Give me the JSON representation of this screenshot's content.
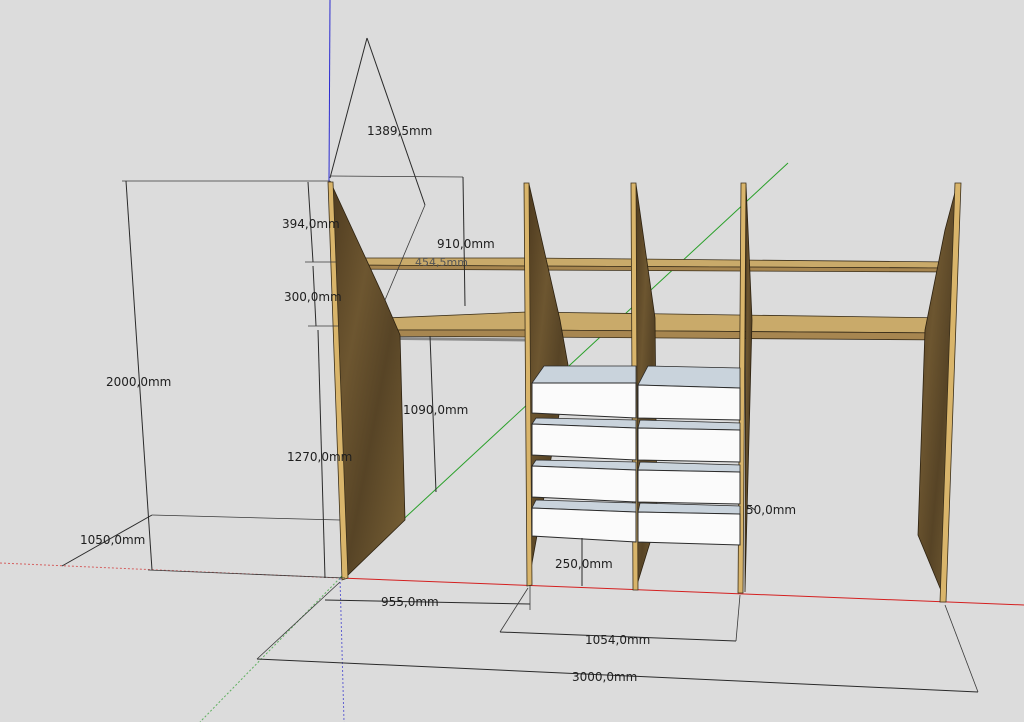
{
  "dimensions": {
    "total_height": "2000,0mm",
    "depth": "1050,0mm",
    "upper_gap": "394,0mm",
    "middle_gap": "300,0mm",
    "lower_height": "1270,0mm",
    "slope_length": "1389,5mm",
    "top_width": "910,0mm",
    "overlap_label": "454,5mm",
    "rail_height": "1090,0mm",
    "first_section": "955,0mm",
    "drawer_section": "1054,0mm",
    "drawer_offset": "250,0mm",
    "total_width": "3000,0mm",
    "drawer_gap": "50,0mm"
  },
  "axes": {
    "red": "#d42020",
    "green": "#2aa02a",
    "blue": "#2a2ad0"
  },
  "colors": {
    "background": "#dcdcdc",
    "wood_dark": "#5a4527",
    "wood_light": "#c9aa6a",
    "drawer": "#fbfbfb"
  }
}
